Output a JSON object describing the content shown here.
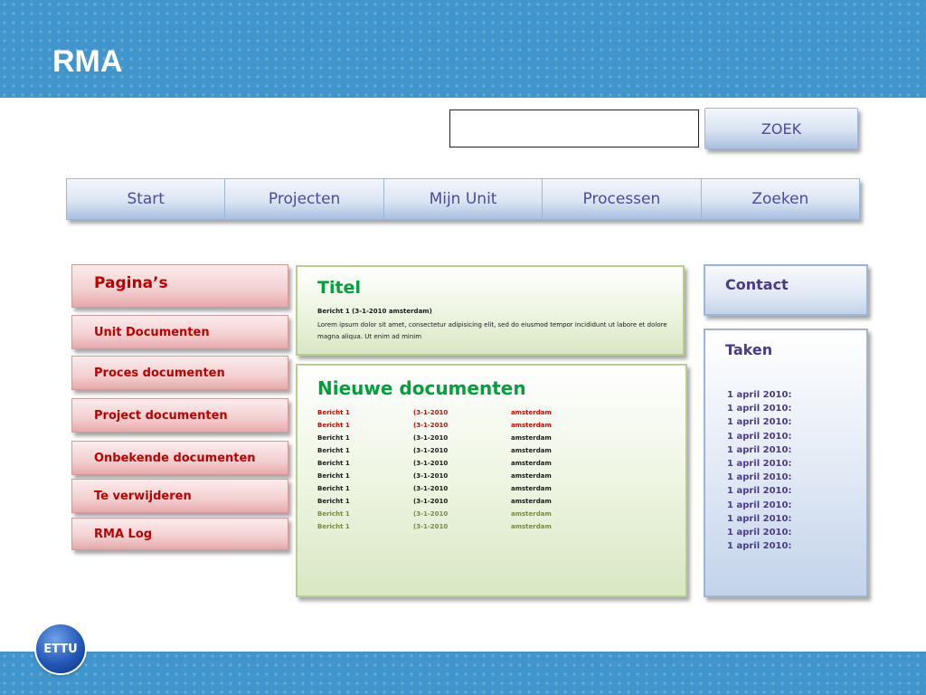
{
  "app": {
    "title": "RMA"
  },
  "search": {
    "value": "",
    "placeholder": "",
    "button_label": "ZOEK"
  },
  "nav": {
    "tabs": [
      {
        "label": "Start"
      },
      {
        "label": "Projecten"
      },
      {
        "label": "Mijn Unit"
      },
      {
        "label": "Processen"
      },
      {
        "label": "Zoeken"
      }
    ]
  },
  "sidebar": {
    "header": "Pagina’s",
    "items": [
      {
        "label": "Unit Documenten"
      },
      {
        "label": "Proces documenten"
      },
      {
        "label": "Project documenten"
      },
      {
        "label": "Onbekende documenten"
      },
      {
        "label": "Te verwijderen"
      },
      {
        "label": "RMA Log"
      }
    ]
  },
  "article": {
    "title": "Titel",
    "head": "Bericht 1 (3-1-2010 amsterdam)",
    "body": "Lorem ipsum dolor sit amet, consectetur adipisicing elit, sed do eiusmod tempor incididunt ut labore et dolore magna aliqua. Ut enim ad minim"
  },
  "new_docs": {
    "title": "Nieuwe documenten",
    "rows": [
      {
        "name": "Bericht 1",
        "date": "(3-1-2010",
        "place": "amsterdam"
      },
      {
        "name": "Bericht 1",
        "date": "(3-1-2010",
        "place": "amsterdam"
      },
      {
        "name": "Bericht 1",
        "date": "(3-1-2010",
        "place": "amsterdam"
      },
      {
        "name": "Bericht 1",
        "date": "(3-1-2010",
        "place": "amsterdam"
      },
      {
        "name": "Bericht 1",
        "date": "(3-1-2010",
        "place": "amsterdam"
      },
      {
        "name": "Bericht 1",
        "date": "(3-1-2010",
        "place": "amsterdam"
      },
      {
        "name": "Bericht 1",
        "date": "(3-1-2010",
        "place": "amsterdam"
      },
      {
        "name": "Bericht 1",
        "date": "(3-1-2010",
        "place": "amsterdam"
      },
      {
        "name": "Bericht 1",
        "date": "(3-1-2010",
        "place": "amsterdam"
      },
      {
        "name": "Bericht 1",
        "date": "(3-1-2010",
        "place": "amsterdam"
      }
    ]
  },
  "contact": {
    "title": "Contact"
  },
  "tasks": {
    "title": "Taken",
    "items": [
      "1 april 2010:",
      "1 april 2010:",
      "1 april 2010:",
      "1 april 2010:",
      "1 april 2010:",
      "1 april 2010:",
      "1 april 2010:",
      "1 april 2010:",
      "1 april 2010:",
      "1 april 2010:",
      "1 april 2010:",
      "1 april 2010:"
    ]
  },
  "logo": {
    "text": "ETTU"
  },
  "colors": {
    "band": "#3f95cc",
    "nav_text": "#4b4aa0",
    "sidebar_text": "#c00000",
    "green_title": "#00a13a",
    "blue_title": "#4b3a8c"
  }
}
